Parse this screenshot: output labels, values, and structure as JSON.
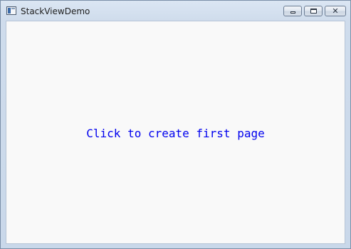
{
  "window": {
    "title": "StackViewDemo",
    "controls": {
      "minimize_icon": "minimize-icon",
      "maximize_icon": "maximize-icon",
      "close_icon": "close-icon",
      "close_glyph": "✕"
    }
  },
  "content": {
    "create_page_label": "Click to create first page",
    "link_color": "#0000ee",
    "background_color": "#f9f9f9"
  }
}
